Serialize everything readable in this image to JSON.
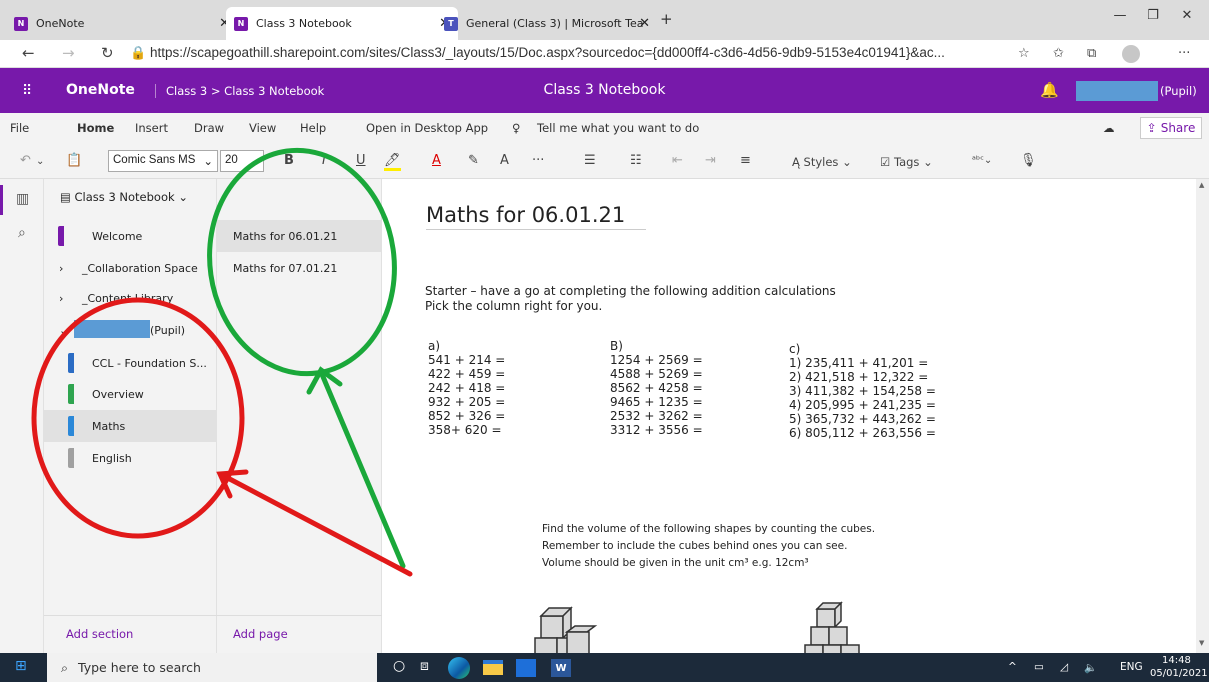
{
  "browser": {
    "tabs": [
      {
        "label": "OneNote",
        "icon": "onenote-icon"
      },
      {
        "label": "Class 3 Notebook",
        "icon": "onenote-icon"
      },
      {
        "label": "General (Class 3) | Microsoft Tea",
        "icon": "teams-icon"
      }
    ],
    "new_tab": "+",
    "url": "https://scapegoathill.sharepoint.com/sites/Class3/_layouts/15/Doc.aspx?sourcedoc={dd000ff4-c3d6-4d56-9db9-5153e4c01941}&ac...",
    "more": "···"
  },
  "header": {
    "app_name": "OneNote",
    "breadcrumb": "Class 3 > Class 3 Notebook",
    "title": "Class 3 Notebook",
    "user_suffix": "(Pupil)"
  },
  "menu": {
    "items": [
      "File",
      "Home",
      "Insert",
      "Draw",
      "View",
      "Help",
      "Open in Desktop App"
    ],
    "tell_me": "Tell me what you want to do",
    "share": "Share"
  },
  "toolbar": {
    "font_name": "Comic Sans MS",
    "font_size": "20",
    "bold": "B",
    "italic": "I",
    "underline": "U",
    "ellipsis": "···",
    "styles": "Styles",
    "tags": "Tags"
  },
  "sections": {
    "notebook": "Class 3 Notebook",
    "items": [
      {
        "label": "Welcome",
        "color": "#7719aa"
      },
      {
        "label": "_Collaboration Space",
        "color": ""
      },
      {
        "label": "_Content Library",
        "color": ""
      },
      {
        "label": "(Pupil)",
        "color": ""
      },
      {
        "label": "CCL - Foundation S...",
        "color": "#2b6cc4"
      },
      {
        "label": "Overview",
        "color": "#2ea44f"
      },
      {
        "label": "Maths",
        "color": "#2b88d8"
      },
      {
        "label": "English",
        "color": "#a0a0a0"
      }
    ],
    "add_section": "Add section"
  },
  "pages": {
    "items": [
      "Maths for 06.01.21",
      "Maths for 07.01.21"
    ],
    "add_page": "Add page"
  },
  "canvas": {
    "title": "Maths for 06.01.21",
    "starter1": "Starter – have a go at completing the following addition calculations",
    "starter2": "Pick the column right for you.",
    "col_a": [
      "a)",
      "541 + 214 =",
      "422 + 459 =",
      "242 + 418 =",
      "932 + 205 =",
      "852 + 326 =",
      "358+ 620 ="
    ],
    "col_b": [
      "B)",
      "1254 + 2569 =",
      "4588 + 5269 =",
      "8562 + 4258 =",
      "9465 + 1235 =",
      "2532 + 3262 =",
      "3312 + 3556 ="
    ],
    "col_c": [
      "c)",
      "1) 235,411 + 41,201 =",
      "2) 421,518 + 12,322 =",
      "3) 411,382 + 154,258 =",
      "4) 205,995 + 241,235 =",
      "5) 365,732 + 443,262 =",
      "6) 805,112 + 263,556 ="
    ],
    "volume1": "Find the volume of the following shapes by counting the cubes.",
    "volume2": "Remember to include the cubes behind ones you can see.",
    "volume3": "Volume should be given in the unit cm³ e.g. 12cm³"
  },
  "taskbar": {
    "search": "Type here to search",
    "lang": "ENG",
    "time": "14:48",
    "date": "05/01/2021"
  },
  "annotations": {
    "red": "#e11919",
    "green": "#1aa83a"
  }
}
